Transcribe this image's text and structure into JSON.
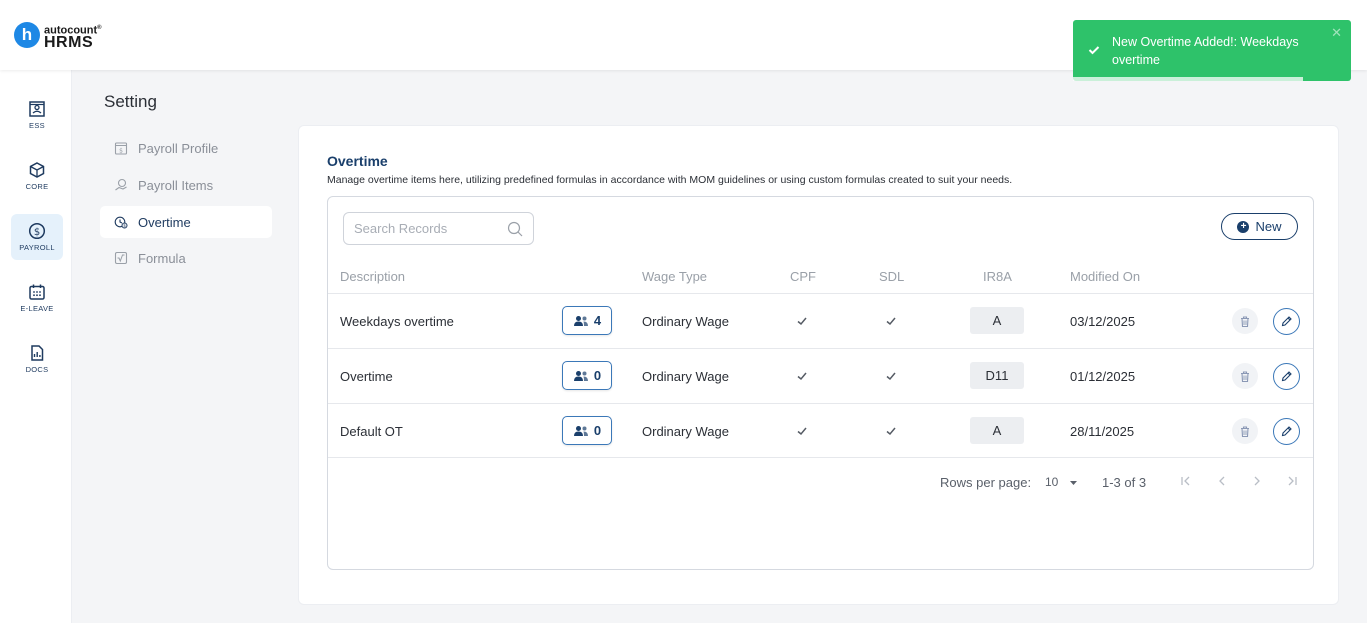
{
  "app": {
    "logo_letter": "h",
    "brand": "autocount",
    "brand_mark": "®",
    "product": "HRMS"
  },
  "sidebar": {
    "items": [
      {
        "label": "ESS",
        "icon": "ess-icon"
      },
      {
        "label": "CORE",
        "icon": "core-icon"
      },
      {
        "label": "PAYROLL",
        "icon": "payroll-icon",
        "active": true
      },
      {
        "label": "E-LEAVE",
        "icon": "calendar-icon"
      },
      {
        "label": "DOCS",
        "icon": "docs-icon"
      }
    ]
  },
  "settings": {
    "title": "Setting",
    "menu": [
      {
        "label": "Payroll Profile",
        "icon": "payroll-profile-icon"
      },
      {
        "label": "Payroll Items",
        "icon": "payroll-items-icon"
      },
      {
        "label": "Overtime",
        "icon": "overtime-icon",
        "active": true
      },
      {
        "label": "Formula",
        "icon": "formula-icon"
      }
    ]
  },
  "main": {
    "title": "Overtime",
    "description": "Manage overtime items here, utilizing predefined formulas in accordance with MOM guidelines or using custom formulas created to suit your needs.",
    "search_placeholder": "Search Records",
    "new_button": "New",
    "columns": {
      "description": "Description",
      "wage_type": "Wage Type",
      "cpf": "CPF",
      "sdl": "SDL",
      "ir8a": "IR8A",
      "modified_on": "Modified On"
    },
    "rows": [
      {
        "description": "Weekdays overtime",
        "employees": "4",
        "wage_type": "Ordinary Wage",
        "cpf": true,
        "sdl": true,
        "ir8a": "A",
        "modified_on": "03/12/2025"
      },
      {
        "description": "Overtime",
        "employees": "0",
        "wage_type": "Ordinary Wage",
        "cpf": true,
        "sdl": true,
        "ir8a": "D11",
        "modified_on": "01/12/2025"
      },
      {
        "description": "Default OT",
        "employees": "0",
        "wage_type": "Ordinary Wage",
        "cpf": true,
        "sdl": true,
        "ir8a": "A",
        "modified_on": "28/11/2025"
      }
    ],
    "pagination": {
      "rows_per_page_label": "Rows per page:",
      "rows_per_page_value": "10",
      "range": "1-3 of 3"
    }
  },
  "toast": {
    "message": "New Overtime Added!: Weekdays overtime",
    "close_symbol": "✕"
  },
  "colors": {
    "primary": "#1a3f6b",
    "accent": "#1e88e5",
    "success": "#2ec26a"
  }
}
